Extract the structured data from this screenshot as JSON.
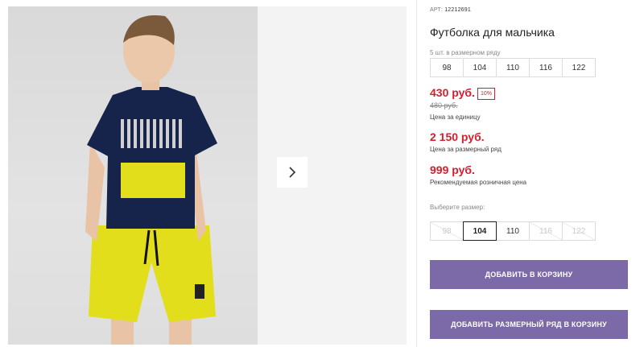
{
  "product": {
    "sku_label": "АРТ:",
    "sku_value": "12212691",
    "title": "Футболка для мальчика",
    "row_label": "5 шт. в размерном ряду",
    "row_sizes": [
      "98",
      "104",
      "110",
      "116",
      "122"
    ],
    "price": "430 руб.",
    "discount": "10%",
    "old_price": "480 руб.",
    "unit_label": "Цена за единицу",
    "row_price": "2 150 руб.",
    "row_price_label": "Цена за размерный ряд",
    "rrp_price": "999 руб.",
    "rrp_label": "Рекомендуемая розничная цена",
    "choose_size_label": "Выберите размер:",
    "size_options": [
      {
        "label": "98",
        "state": "disabled"
      },
      {
        "label": "104",
        "state": "selected"
      },
      {
        "label": "110",
        "state": "available"
      },
      {
        "label": "116",
        "state": "disabled"
      },
      {
        "label": "122",
        "state": "disabled"
      }
    ],
    "add_to_cart": "ДОБАВИТЬ В КОРЗИНУ",
    "add_row_to_cart": "ДОБАВИТЬ РАЗМЕРНЫЙ РЯД В КОРЗИНУ"
  },
  "icons": {
    "next": "chevron-right-icon"
  },
  "colors": {
    "accent_button": "#7c69a8",
    "price_red": "#d2202f",
    "shirt_navy": "#16234a",
    "shorts_yellow": "#e2de1c"
  }
}
